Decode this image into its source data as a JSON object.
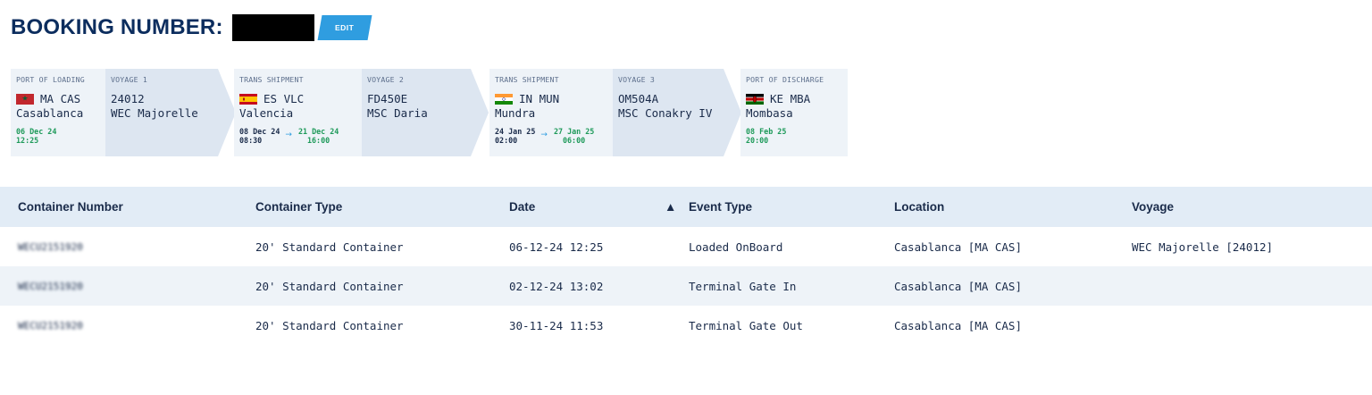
{
  "header": {
    "title": "BOOKING NUMBER:",
    "edit_label": "EDIT"
  },
  "route": [
    {
      "port_label": "PORT OF LOADING",
      "code": "MA CAS",
      "city": "Casablanca",
      "date": "06 Dec 24",
      "time": "12:25",
      "flag": "morocco-flag",
      "voyage_label": "VOYAGE 1",
      "voyage_no": "24012",
      "vessel": "WEC Majorelle"
    },
    {
      "port_label": "TRANS SHIPMENT",
      "code": "ES VLC",
      "city": "Valencia",
      "arr_date": "08 Dec 24",
      "arr_time": "08:30",
      "dep_date": "21 Dec 24",
      "dep_time": "16:00",
      "flag": "spain-flag",
      "voyage_label": "VOYAGE 2",
      "voyage_no": "FD450E",
      "vessel": "MSC Daria"
    },
    {
      "port_label": "TRANS SHIPMENT",
      "code": "IN MUN",
      "city": "Mundra",
      "arr_date": "24 Jan 25",
      "arr_time": "02:00",
      "dep_date": "27 Jan 25",
      "dep_time": "06:00",
      "flag": "india-flag",
      "voyage_label": "VOYAGE 3",
      "voyage_no": "OM504A",
      "vessel": "MSC Conakry IV"
    },
    {
      "port_label": "PORT OF DISCHARGE",
      "code": "KE MBA",
      "city": "Mombasa",
      "date": "08 Feb 25",
      "time": "20:00",
      "flag": "kenya-flag"
    }
  ],
  "arrow_glyph": "→",
  "table": {
    "headers": [
      "Container Number",
      "Container Type",
      "Date",
      "Event Type",
      "Location",
      "Voyage"
    ],
    "sort_glyph": "▲",
    "rows": [
      [
        "WECU2151920",
        "20' Standard Container",
        "06-12-24 12:25",
        "Loaded OnBoard",
        "Casablanca [MA CAS]",
        "WEC Majorelle [24012]"
      ],
      [
        "WECU2151920",
        "20' Standard Container",
        "02-12-24 13:02",
        "Terminal Gate In",
        "Casablanca [MA CAS]",
        ""
      ],
      [
        "WECU2151920",
        "20' Standard Container",
        "30-11-24 11:53",
        "Terminal Gate Out",
        "Casablanca [MA CAS]",
        ""
      ]
    ]
  },
  "colors": {
    "brand_navy": "#0c2d5e",
    "accent_blue": "#2f9de0",
    "date_green": "#1e9a5a",
    "card_bg": "#eef3f8",
    "voyage_bg": "#dde6f1",
    "header_bg": "#e2ecf6"
  }
}
